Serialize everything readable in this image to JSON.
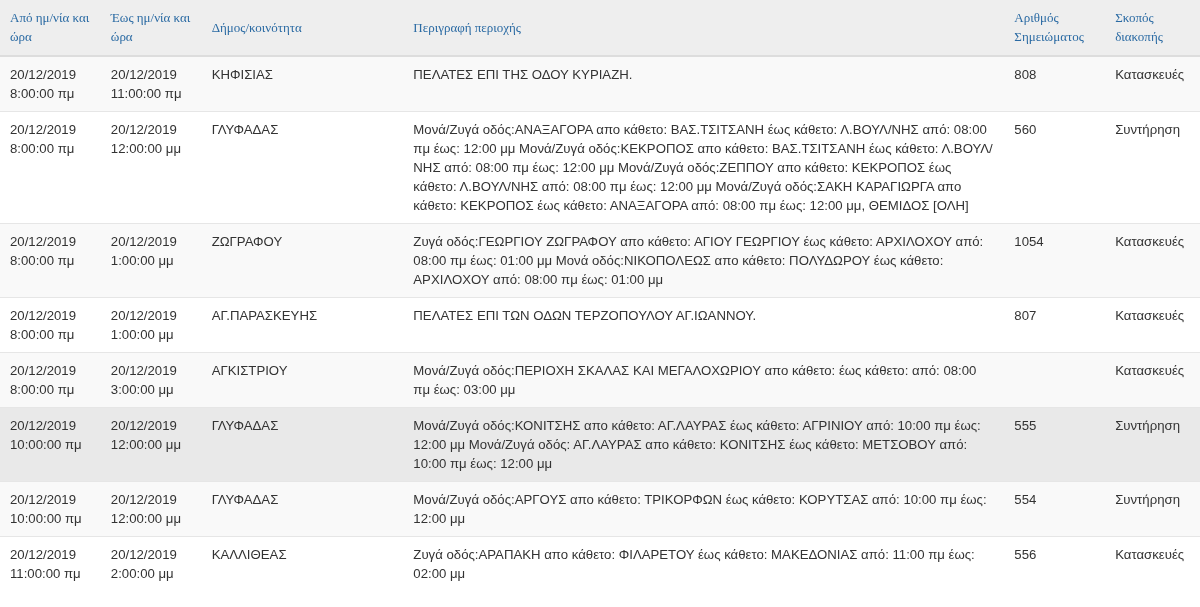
{
  "table": {
    "columns": [
      "Από ημ/νία και ώρα",
      "Έως ημ/νία και ώρα",
      "Δήμος/κοινότητα",
      "Περιγραφή περιοχής",
      "Αριθμός Σημειώματος",
      "Σκοπός διακοπής"
    ],
    "rows": [
      {
        "highlighted": false,
        "cells": [
          "20/12/2019 8:00:00 πμ",
          "20/12/2019 11:00:00 πμ",
          "ΚΗΦΙΣΙΑΣ",
          "ΠΕΛΑΤΕΣ ΕΠΙ ΤΗΣ ΟΔΟΥ ΚΥΡΙΑΖΗ.",
          "808",
          "Κατασκευές"
        ]
      },
      {
        "highlighted": false,
        "cells": [
          "20/12/2019 8:00:00 πμ",
          "20/12/2019 12:00:00 μμ",
          "ΓΛΥΦΑΔΑΣ",
          "Μονά/Ζυγά οδός:ΑΝΑΞΑΓΟΡΑ απο κάθετο: ΒΑΣ.ΤΣΙΤΣΑΝΗ έως κάθετο: Λ.ΒΟΥΛ/ΝΗΣ από: 08:00 πμ έως: 12:00 μμ Μονά/Ζυγά οδός:ΚΕΚΡΟΠΟΣ απο κάθετο: ΒΑΣ.ΤΣΙΤΣΑΝΗ έως κάθετο: Λ.ΒΟΥΛ/ΝΗΣ από: 08:00 πμ έως: 12:00 μμ Μονά/Ζυγά οδός:ΖΕΠΠΟΥ απο κάθετο: ΚΕΚΡΟΠΟΣ έως κάθετο: Λ.ΒΟΥΛ/ΝΗΣ από: 08:00 πμ έως: 12:00 μμ Μονά/Ζυγά οδός:ΣΑΚΗ ΚΑΡΑΓΙΩΡΓΑ απο κάθετο: ΚΕΚΡΟΠΟΣ έως κάθετο: ΑΝΑΞΑΓΟΡΑ από: 08:00 πμ έως: 12:00 μμ, ΘΕΜΙΔΟΣ [ΟΛΗ]",
          "560",
          "Συντήρηση"
        ]
      },
      {
        "highlighted": false,
        "cells": [
          "20/12/2019 8:00:00 πμ",
          "20/12/2019 1:00:00 μμ",
          "ΖΩΓΡΑΦΟΥ",
          "Ζυγά οδός:ΓΕΩΡΓΙΟΥ ΖΩΓΡΑΦΟΥ απο κάθετο: ΑΓΙΟΥ ΓΕΩΡΓΙΟΥ έως κάθετο: ΑΡΧΙΛΟΧΟΥ από: 08:00 πμ έως: 01:00 μμ Μονά οδός:ΝΙΚΟΠΟΛΕΩΣ απο κάθετο: ΠΟΛΥΔΩΡΟΥ έως κάθετο: ΑΡΧΙΛΟΧΟΥ από: 08:00 πμ έως: 01:00 μμ",
          "1054",
          "Κατασκευές"
        ]
      },
      {
        "highlighted": false,
        "cells": [
          "20/12/2019 8:00:00 πμ",
          "20/12/2019 1:00:00 μμ",
          "ΑΓ.ΠΑΡΑΣΚΕΥΗΣ",
          "ΠΕΛΑΤΕΣ ΕΠΙ ΤΩΝ ΟΔΩΝ ΤΕΡΖΟΠΟΥΛΟΥ ΑΓ.ΙΩΑΝΝΟΥ.",
          "807",
          "Κατασκευές"
        ]
      },
      {
        "highlighted": false,
        "cells": [
          "20/12/2019 8:00:00 πμ",
          "20/12/2019 3:00:00 μμ",
          "ΑΓΚΙΣΤΡΙΟΥ",
          "Μονά/Ζυγά οδός:ΠΕΡΙΟΧΗ ΣΚΑΛΑΣ ΚΑΙ ΜΕΓΑΛΟΧΩΡΙΟΥ απο κάθετο: έως κάθετο: από: 08:00 πμ έως: 03:00 μμ",
          "",
          "Κατασκευές"
        ]
      },
      {
        "highlighted": true,
        "cells": [
          "20/12/2019 10:00:00 πμ",
          "20/12/2019 12:00:00 μμ",
          "ΓΛΥΦΑΔΑΣ",
          "Μονά/Ζυγά οδός:ΚΟΝΙΤΣΗΣ απο κάθετο: ΑΓ.ΛΑΥΡΑΣ έως κάθετο: ΑΓΡΙΝΙΟΥ από: 10:00 πμ έως: 12:00 μμ Μονά/Ζυγά οδός: ΑΓ.ΛΑΥΡΑΣ απο κάθετο: ΚΟΝΙΤΣΗΣ έως κάθετο: ΜΕΤΣΟΒΟΥ από: 10:00 πμ έως: 12:00 μμ",
          "555",
          "Συντήρηση"
        ]
      },
      {
        "highlighted": false,
        "cells": [
          "20/12/2019 10:00:00 πμ",
          "20/12/2019 12:00:00 μμ",
          "ΓΛΥΦΑΔΑΣ",
          "Μονά/Ζυγά οδός:ΑΡΓΟΥΣ απο κάθετο: ΤΡΙΚΟΡΦΩΝ έως κάθετο: ΚΟΡΥΤΣΑΣ από: 10:00 πμ έως: 12:00 μμ",
          "554",
          "Συντήρηση"
        ]
      },
      {
        "highlighted": false,
        "cells": [
          "20/12/2019 11:00:00 πμ",
          "20/12/2019 2:00:00 μμ",
          "ΚΑΛΛΙΘΕΑΣ",
          "Ζυγά οδός:ΑΡΑΠΑΚΗ απο κάθετο: ΦΙΛΑΡΕΤΟΥ έως κάθετο: ΜΑΚΕΔΟΝΙΑΣ από: 11:00 πμ έως: 02:00 μμ",
          "556",
          "Κατασκευές"
        ]
      }
    ]
  }
}
